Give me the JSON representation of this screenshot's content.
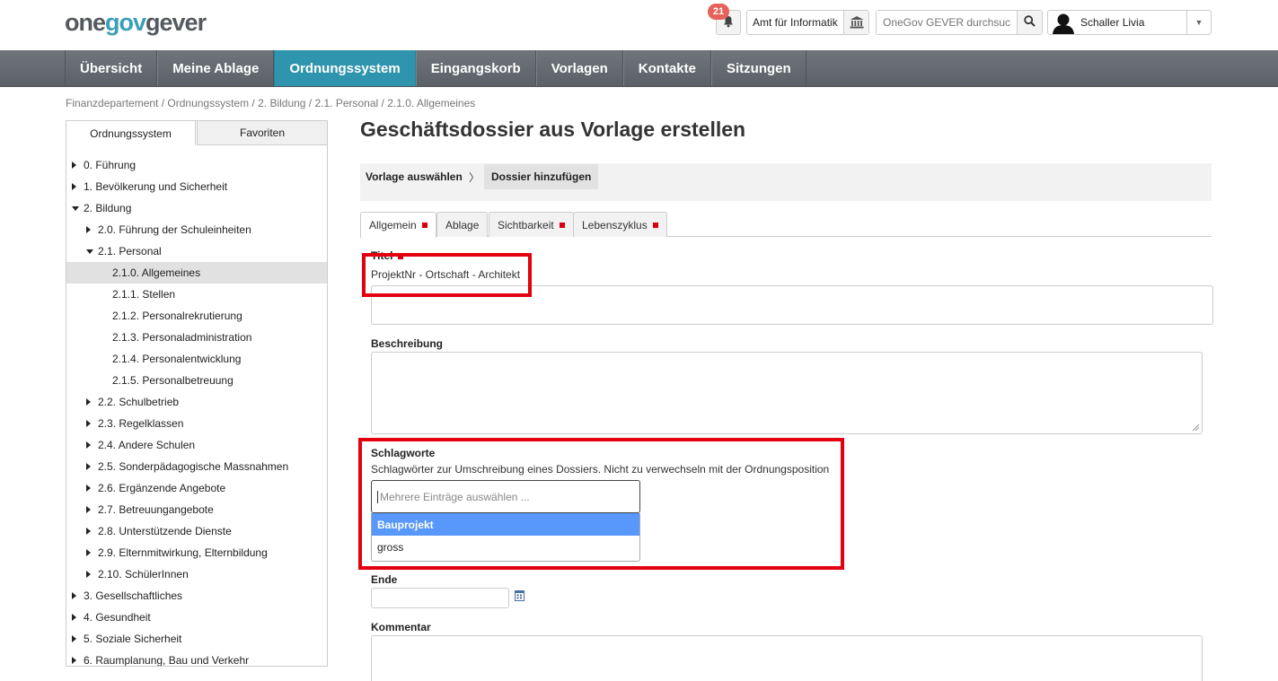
{
  "header": {
    "logo": {
      "one": "one",
      "gov": "gov",
      "gever": "gever"
    },
    "notification_count": "21",
    "org_unit": "Amt für Informatik",
    "search_placeholder": "OneGov GEVER durchsuc",
    "user_name": "Schaller Livia"
  },
  "nav": {
    "items": [
      "Übersicht",
      "Meine Ablage",
      "Ordnungssystem",
      "Eingangskorb",
      "Vorlagen",
      "Kontakte",
      "Sitzungen"
    ],
    "active": "Ordnungssystem"
  },
  "breadcrumb": "Finanzdepartement / Ordnungssystem / 2. Bildung / 2.1. Personal / 2.1.0. Allgemeines",
  "sidebar": {
    "tabs": [
      "Ordnungssystem",
      "Favoriten"
    ],
    "tree": [
      {
        "label": "0. Führung",
        "level": 0,
        "state": "closed"
      },
      {
        "label": "1. Bevölkerung und Sicherheit",
        "level": 0,
        "state": "closed"
      },
      {
        "label": "2. Bildung",
        "level": 0,
        "state": "open"
      },
      {
        "label": "2.0. Führung der Schuleinheiten",
        "level": 1,
        "state": "closed"
      },
      {
        "label": "2.1. Personal",
        "level": 1,
        "state": "open"
      },
      {
        "label": "2.1.0. Allgemeines",
        "level": 2,
        "state": "leaf",
        "selected": true
      },
      {
        "label": "2.1.1. Stellen",
        "level": 2,
        "state": "leaf"
      },
      {
        "label": "2.1.2. Personalrekrutierung",
        "level": 2,
        "state": "leaf"
      },
      {
        "label": "2.1.3. Personaladministration",
        "level": 2,
        "state": "leaf"
      },
      {
        "label": "2.1.4. Personalentwicklung",
        "level": 2,
        "state": "leaf"
      },
      {
        "label": "2.1.5. Personalbetreuung",
        "level": 2,
        "state": "leaf"
      },
      {
        "label": "2.2. Schulbetrieb",
        "level": 1,
        "state": "closed"
      },
      {
        "label": "2.3. Regelklassen",
        "level": 1,
        "state": "closed"
      },
      {
        "label": "2.4. Andere Schulen",
        "level": 1,
        "state": "closed"
      },
      {
        "label": "2.5. Sonderpädagogische Massnahmen",
        "level": 1,
        "state": "closed"
      },
      {
        "label": "2.6. Ergänzende Angebote",
        "level": 1,
        "state": "closed"
      },
      {
        "label": "2.7. Betreuungangebote",
        "level": 1,
        "state": "closed"
      },
      {
        "label": "2.8. Unterstützende Dienste",
        "level": 1,
        "state": "closed"
      },
      {
        "label": "2.9. Elternmitwirkung, Elternbildung",
        "level": 1,
        "state": "closed"
      },
      {
        "label": "2.10. SchülerInnen",
        "level": 1,
        "state": "closed"
      },
      {
        "label": "3. Gesellschaftliches",
        "level": 0,
        "state": "closed"
      },
      {
        "label": "4. Gesundheit",
        "level": 0,
        "state": "closed"
      },
      {
        "label": "5. Soziale Sicherheit",
        "level": 0,
        "state": "closed"
      },
      {
        "label": "6. Raumplanung, Bau und Verkehr",
        "level": 0,
        "state": "closed"
      }
    ]
  },
  "main": {
    "title": "Geschäftsdossier aus Vorlage erstellen",
    "wizard": {
      "step1": "Vorlage auswählen",
      "chevron": "〉",
      "step2": "Dossier hinzufügen"
    },
    "form_tabs": [
      {
        "label": "Allgemein",
        "required": true
      },
      {
        "label": "Ablage",
        "required": false
      },
      {
        "label": "Sichtbarkeit",
        "required": true
      },
      {
        "label": "Lebenszyklus",
        "required": true
      }
    ],
    "titel_label": "Titel",
    "titel_hint": "ProjektNr - Ortschaft - Architekt",
    "beschreibung_label": "Beschreibung",
    "schlagworte_label": "Schlagworte",
    "schlagworte_hint": "Schlagwörter zur Umschreibung eines Dossiers. Nicht zu verwechseln mit der Ordnungsposition",
    "schlagworte_placeholder": "Mehrere Einträge auswählen ...",
    "schlagworte_options": [
      "Bauprojekt",
      "gross"
    ],
    "ende_label": "Ende",
    "kommentar_label": "Kommentar"
  },
  "colors": {
    "nav_active": "#2f94ad",
    "highlight": "#e3000f",
    "option_highlight": "#5897fb",
    "required_marker": "#d8000c"
  }
}
